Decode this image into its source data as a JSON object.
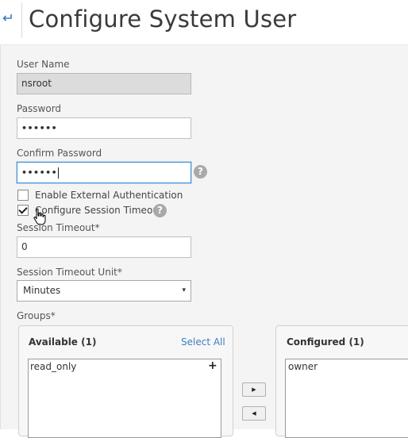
{
  "header": {
    "title": "Configure System User",
    "back_icon": "back-arrow-icon"
  },
  "form": {
    "user_name": {
      "label": "User Name",
      "value": "nsroot"
    },
    "password": {
      "label": "Password",
      "value": "••••••"
    },
    "confirm_password": {
      "label": "Confirm Password",
      "value": "••••••",
      "help_icon": "help-icon"
    },
    "enable_external_auth": {
      "label": "Enable External Authentication",
      "checked": false
    },
    "configure_session_timeout": {
      "label": "Configure Session Timeout",
      "checked": true,
      "help_icon": "help-icon"
    },
    "session_timeout": {
      "label": "Session Timeout*",
      "value": "0"
    },
    "session_timeout_unit": {
      "label": "Session Timeout Unit*",
      "selected": "Minutes",
      "arrow": "▾"
    }
  },
  "groups": {
    "label": "Groups*",
    "available": {
      "title": "Available (1)",
      "select_all": "Select All",
      "items": [
        "read_only"
      ],
      "add_symbol": "+"
    },
    "configured": {
      "title": "Configured (1)",
      "items": [
        "owner"
      ]
    },
    "move_right_symbol": "▶",
    "move_left_symbol": "◀"
  },
  "colors": {
    "link": "#3a7fc1",
    "focus_border": "#4a90d9",
    "panel_bg": "#f4f4f4"
  }
}
